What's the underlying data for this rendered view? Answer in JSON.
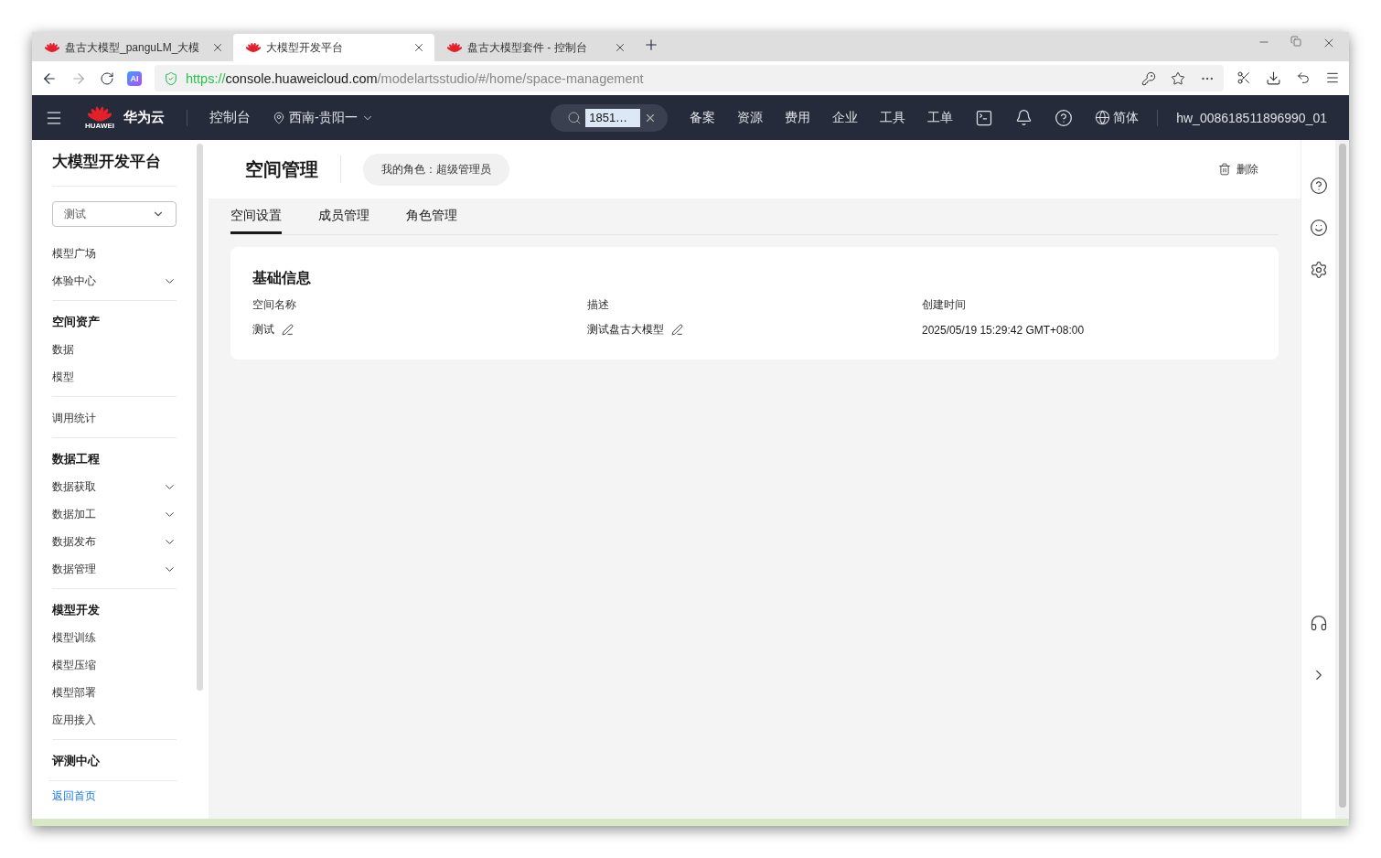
{
  "browser": {
    "tabs": [
      {
        "title": "盘古大模型_panguLM_大模",
        "selected": false
      },
      {
        "title": "大模型开发平台",
        "selected": true
      },
      {
        "title": "盘古大模型套件 - 控制台",
        "selected": false
      }
    ],
    "ai_badge": "AI",
    "url": {
      "scheme": "https://",
      "host": "console.huaweicloud.com",
      "path": "/modelartsstudio/#/home/space-management"
    }
  },
  "topbar": {
    "logo_caption": "HUAWEI",
    "brand": "华为云",
    "console": "控制台",
    "region": "西南-贵阳一",
    "search_value": "1851…",
    "links": [
      "备案",
      "资源",
      "费用",
      "企业",
      "工具",
      "工单"
    ],
    "language": "简体",
    "user": "hw_008618511896990_01"
  },
  "sidebar": {
    "title": "大模型开发平台",
    "space_select": "测试",
    "sections": [
      {
        "items": [
          {
            "label": "模型广场",
            "kind": "link"
          },
          {
            "label": "体验中心",
            "kind": "menu"
          }
        ]
      },
      {
        "title": "空间资产",
        "items": [
          {
            "label": "数据",
            "kind": "link"
          },
          {
            "label": "模型",
            "kind": "link"
          }
        ]
      },
      {
        "items": [
          {
            "label": "调用统计",
            "kind": "link"
          }
        ]
      },
      {
        "title": "数据工程",
        "items": [
          {
            "label": "数据获取",
            "kind": "menu"
          },
          {
            "label": "数据加工",
            "kind": "menu"
          },
          {
            "label": "数据发布",
            "kind": "menu"
          },
          {
            "label": "数据管理",
            "kind": "menu"
          }
        ]
      },
      {
        "title": "模型开发",
        "items": [
          {
            "label": "模型训练",
            "kind": "link"
          },
          {
            "label": "模型压缩",
            "kind": "link"
          },
          {
            "label": "模型部署",
            "kind": "link"
          },
          {
            "label": "应用接入",
            "kind": "link"
          }
        ]
      },
      {
        "title": "评测中心"
      }
    ],
    "footer_link": "返回首页"
  },
  "page": {
    "title": "空间管理",
    "role": "我的角色：超级管理员",
    "delete": "删除",
    "tabs": [
      {
        "label": "空间设置",
        "selected": true
      },
      {
        "label": "成员管理",
        "selected": false
      },
      {
        "label": "角色管理",
        "selected": false
      }
    ],
    "card": {
      "title": "基础信息",
      "fields": [
        {
          "label": "空间名称",
          "value": "测试",
          "editable": true
        },
        {
          "label": "描述",
          "value": "测试盘古大模型",
          "editable": true
        },
        {
          "label": "创建时间",
          "value": "2025/05/19 15:29:42 GMT+08:00",
          "editable": false
        }
      ]
    }
  }
}
